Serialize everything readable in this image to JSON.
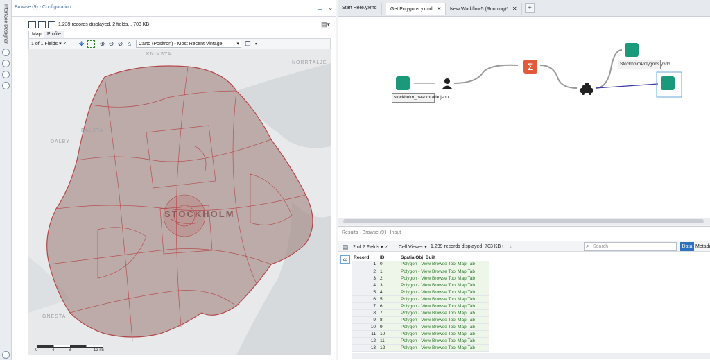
{
  "rail": {
    "tab_label": "Interface Designer"
  },
  "config": {
    "title": "Browse (9) - Configuration",
    "records_info": "1,239 records displayed, 2 fields, , 703 KB",
    "tabs": [
      "Map",
      "Profile"
    ],
    "fields_selector": "1 of 1 Fields",
    "basemap": "Carto (Positron) - Most Recent Vintage",
    "map": {
      "labels": [
        "KNIVSTA",
        "NORRTÄLJE",
        "BÅLSTA",
        "DALBY",
        "GNESTA"
      ],
      "city": "STOCKHOLM",
      "scale": [
        "0",
        "4",
        "8",
        "12 mi"
      ]
    }
  },
  "workflow_tabs": [
    {
      "label": "Start Here.yxmd",
      "closable": false,
      "active": false
    },
    {
      "label": "Get Polygons.yxmd",
      "closable": true,
      "active": true
    },
    {
      "label": "New Workflow5 (Running)*",
      "closable": true,
      "active": false
    }
  ],
  "canvas": {
    "input_annotation": "stockholm_basomrade.json",
    "output_annotation": "StockholmPolygons.yxdb",
    "colors": {
      "input": "#1a9a7a",
      "summarize": "#e15a3a",
      "output": "#1a9a7a",
      "browse": "#1a9a7a",
      "connector": "#3a3aa0"
    }
  },
  "results": {
    "title": "Results - Browse (9) - Input",
    "fields_selector": "2 of 2 Fields",
    "cell_viewer": "Cell Viewer",
    "records_info": "1,239 records displayed, 703 KB",
    "search_placeholder": "Search",
    "data_label": "Data",
    "metadata_label": "Metadata",
    "columns": [
      "Record",
      "ID",
      "SpatialObj_Built"
    ],
    "rows": [
      {
        "record": "1",
        "id": "0",
        "value": "Polygon - View Browse Tool Map Tab"
      },
      {
        "record": "2",
        "id": "1",
        "value": "Polygon - View Browse Tool Map Tab"
      },
      {
        "record": "3",
        "id": "2",
        "value": "Polygon - View Browse Tool Map Tab"
      },
      {
        "record": "4",
        "id": "3",
        "value": "Polygon - View Browse Tool Map Tab"
      },
      {
        "record": "5",
        "id": "4",
        "value": "Polygon - View Browse Tool Map Tab"
      },
      {
        "record": "6",
        "id": "5",
        "value": "Polygon - View Browse Tool Map Tab"
      },
      {
        "record": "7",
        "id": "6",
        "value": "Polygon - View Browse Tool Map Tab"
      },
      {
        "record": "8",
        "id": "7",
        "value": "Polygon - View Browse Tool Map Tab"
      },
      {
        "record": "9",
        "id": "8",
        "value": "Polygon - View Browse Tool Map Tab"
      },
      {
        "record": "10",
        "id": "9",
        "value": "Polygon - View Browse Tool Map Tab"
      },
      {
        "record": "11",
        "id": "10",
        "value": "Polygon - View Browse Tool Map Tab"
      },
      {
        "record": "12",
        "id": "11",
        "value": "Polygon - View Browse Tool Map Tab"
      },
      {
        "record": "13",
        "id": "12",
        "value": "Polygon - View Browse Tool Map Tab"
      }
    ]
  }
}
